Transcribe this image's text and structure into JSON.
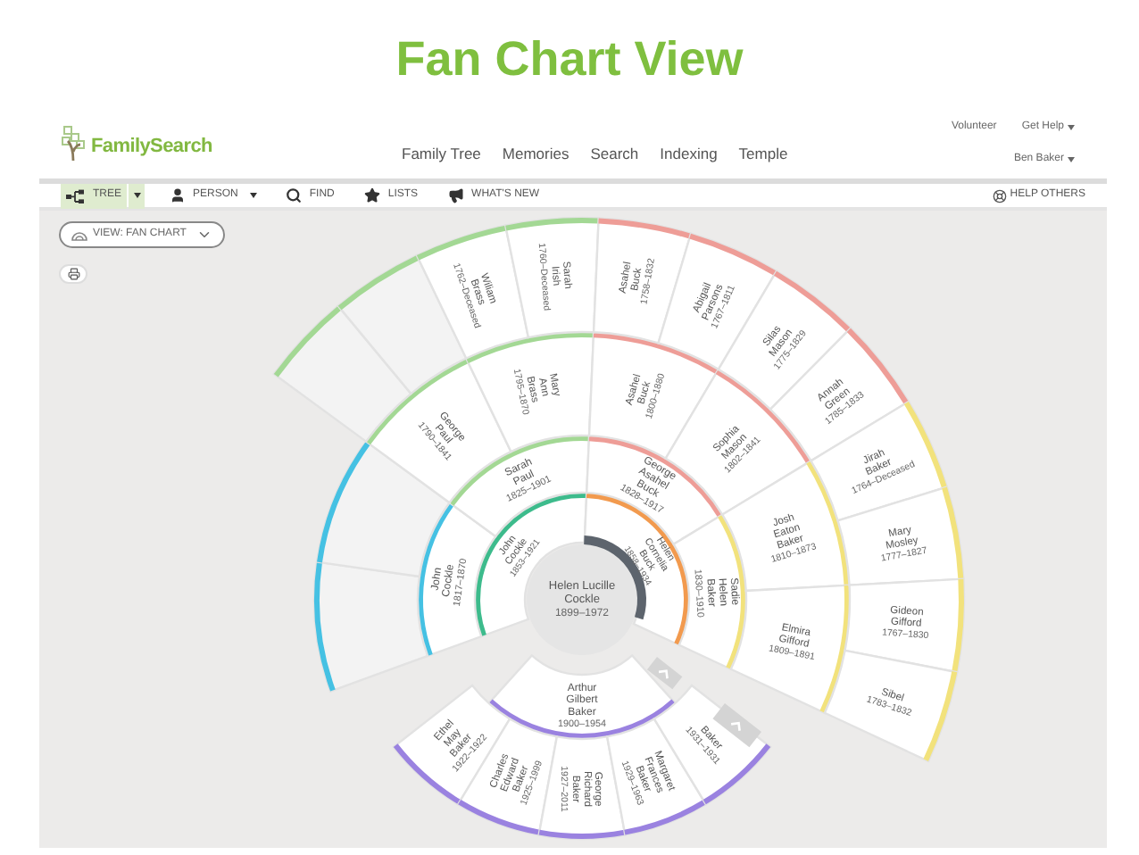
{
  "slide_title": "Fan Chart View",
  "header": {
    "logo": "FamilySearch",
    "nav": [
      {
        "label": "Family Tree",
        "selected": false
      },
      {
        "label": "Memories",
        "selected": false
      },
      {
        "label": "Search",
        "selected": false
      },
      {
        "label": "Indexing",
        "selected": false
      },
      {
        "label": "Temple",
        "selected": false
      }
    ],
    "top_links": [
      "Volunteer",
      "Get Help"
    ],
    "user": "Ben Baker"
  },
  "toolbar": {
    "items": [
      {
        "label": "TREE",
        "kind": "tree",
        "selected": true,
        "dropdown": true
      },
      {
        "label": "PERSON",
        "kind": "person",
        "selected": false,
        "dropdown": true
      },
      {
        "label": "FIND",
        "kind": "find",
        "selected": false,
        "dropdown": false
      },
      {
        "label": "LISTS",
        "kind": "lists",
        "selected": false,
        "dropdown": false
      },
      {
        "label": "WHAT'S NEW",
        "kind": "news",
        "selected": false,
        "dropdown": false
      }
    ],
    "help": "HELP OTHERS"
  },
  "view_select": "VIEW: FAN CHART",
  "fan": {
    "root": {
      "name": "Helen Lucille Cockle",
      "dates": "1899–1972"
    },
    "ancestors": [
      [
        {
          "kind": "person",
          "name": "John Cockle",
          "dates": "1853–1921",
          "color": "#3dbb8c"
        },
        {
          "kind": "person",
          "name": "Helen Cornelia Buck",
          "dates": "1858–1934",
          "color": "#f29a4e"
        }
      ],
      [
        {
          "kind": "person",
          "name": "John Cockle",
          "dates": "1817–1870",
          "color": "#45c1e3"
        },
        {
          "kind": "person",
          "name": "Sarah Paul",
          "dates": "1825–1901",
          "color": "#a3d894"
        },
        {
          "kind": "person",
          "name": "George Asahel Buck",
          "dates": "1828–1917",
          "color": "#ee9d97"
        },
        {
          "kind": "person",
          "name": "Sadie Helen Baker",
          "dates": "1830–1910",
          "color": "#f2e27c"
        }
      ],
      [
        {
          "kind": "empty"
        },
        {
          "kind": "empty"
        },
        {
          "kind": "person",
          "name": "George Paul",
          "dates": "1790–1841"
        },
        {
          "kind": "person",
          "name": "Mary Ann Brass",
          "dates": "1795–1870"
        },
        {
          "kind": "person",
          "name": "Asahel Buck",
          "dates": "1800–1880"
        },
        {
          "kind": "person",
          "name": "Sophia Mason",
          "dates": "1802–1841"
        },
        {
          "kind": "person",
          "name": "Josh Eaton Baker",
          "dates": "1810–1873"
        },
        {
          "kind": "person",
          "name": "Elmira Gifford",
          "dates": "1809–1891"
        }
      ],
      [
        {
          "kind": "none"
        },
        {
          "kind": "none"
        },
        {
          "kind": "none"
        },
        {
          "kind": "none"
        },
        {
          "kind": "empty"
        },
        {
          "kind": "empty"
        },
        {
          "kind": "person",
          "name": "Wiliam Brass",
          "dates": "1762–Deceased"
        },
        {
          "kind": "person",
          "name": "Sarah Irish",
          "dates": "1760–Deceased"
        },
        {
          "kind": "person",
          "name": "Asahel Buck",
          "dates": "1758–1832"
        },
        {
          "kind": "person",
          "name": "Abigail Parsons",
          "dates": "1767–1811"
        },
        {
          "kind": "person",
          "name": "Silas Mason",
          "dates": "1775–1829"
        },
        {
          "kind": "person",
          "name": "Annah Green",
          "dates": "1785–1833"
        },
        {
          "kind": "person",
          "name": "Jirah Baker",
          "dates": "1764–Deceased"
        },
        {
          "kind": "person",
          "name": "Mary Mosley",
          "dates": "1777–1827"
        },
        {
          "kind": "person",
          "name": "Gideon Gifford",
          "dates": "1767–1830"
        },
        {
          "kind": "person",
          "name": "Sibel",
          "dates": "1783–1832"
        }
      ]
    ],
    "spouse": {
      "name": "Arthur Gilbert Baker",
      "dates": "1900–1954",
      "color": "#9a82e0"
    },
    "children": [
      {
        "name": "Ethel May Baker",
        "dates": "1922–1922"
      },
      {
        "name": "Charles Edward Baker",
        "dates": "1925–1999"
      },
      {
        "name": "George Richard Baker",
        "dates": "1927–2011"
      },
      {
        "name": "Margaret Frances Baker",
        "dates": "1929–1963"
      },
      {
        "name": "Baker",
        "dates": "1931–1931"
      }
    ]
  }
}
